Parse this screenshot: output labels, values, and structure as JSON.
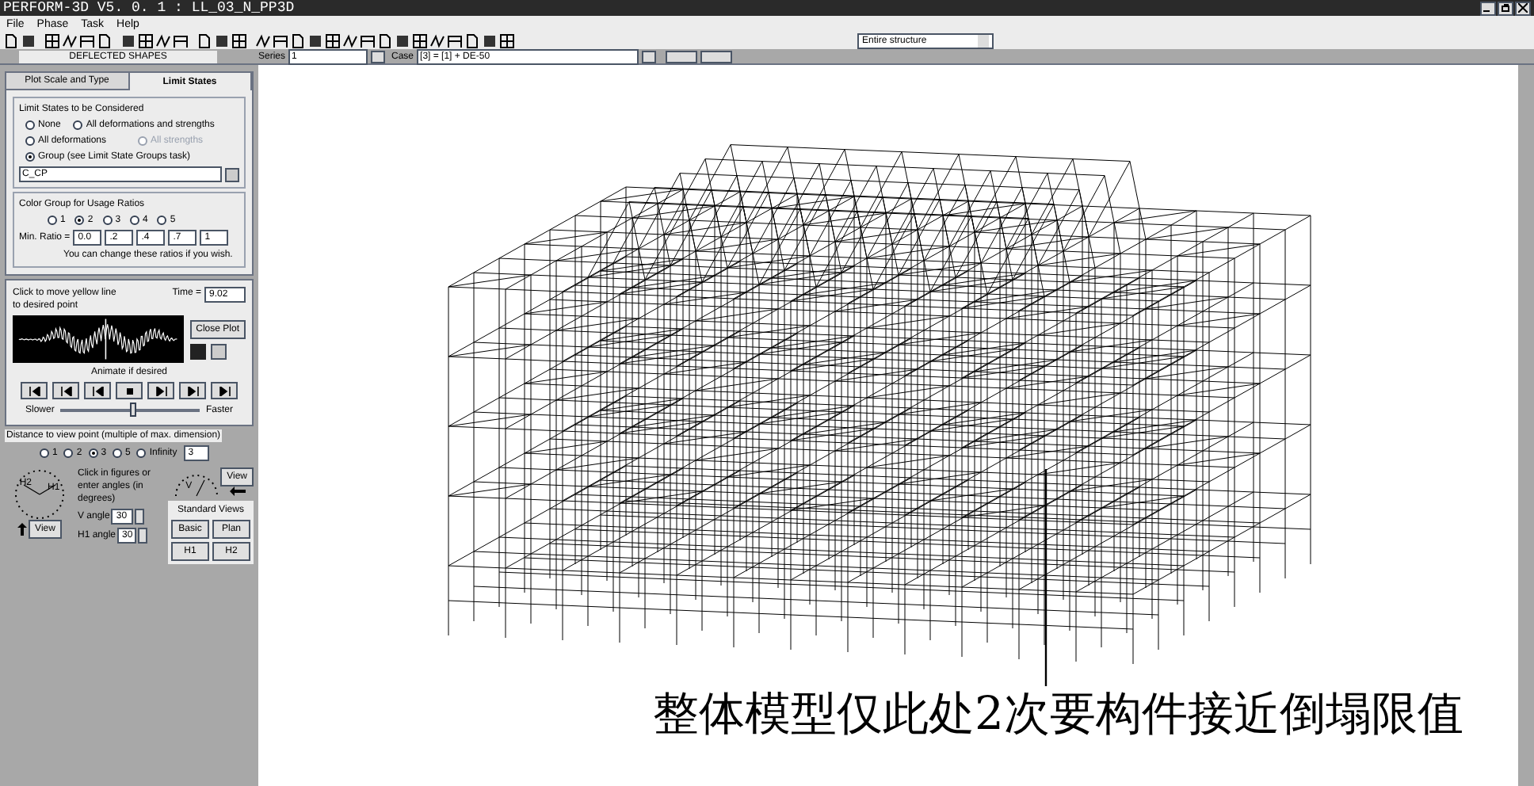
{
  "window": {
    "title": "PERFORM-3D V5. 0. 1 : LL_03_N_PP3D"
  },
  "menu": [
    "File",
    "Phase",
    "Task",
    "Help"
  ],
  "toolbar": {
    "scope": "Entire structure"
  },
  "options_bar": {
    "panel_title": "DEFLECTED SHAPES",
    "series_label": "Series",
    "series": "1",
    "case_label": "Case",
    "case": "[3] = [1] + DE-50"
  },
  "tabs": [
    {
      "label": "Plot Scale and Type",
      "selected": false
    },
    {
      "label": "Limit States",
      "selected": true
    }
  ],
  "limit_states": {
    "title": "Limit States to be Considered",
    "options": [
      {
        "label": "None",
        "selected": false,
        "disabled": false
      },
      {
        "label": "All deformations and strengths",
        "selected": false,
        "disabled": false
      },
      {
        "label": "All deformations",
        "selected": false,
        "disabled": false
      },
      {
        "label": "All strengths",
        "selected": false,
        "disabled": true
      },
      {
        "label": "Group (see Limit State Groups task)",
        "selected": true,
        "disabled": false
      }
    ],
    "group": "C_CP"
  },
  "color_group": {
    "title": "Color Group for Usage Ratios",
    "options": [
      {
        "label": "1",
        "selected": false
      },
      {
        "label": "2",
        "selected": true
      },
      {
        "label": "3",
        "selected": false
      },
      {
        "label": "4",
        "selected": false
      },
      {
        "label": "5",
        "selected": false
      }
    ],
    "ratio_label": "Min. Ratio =",
    "ratios": [
      "0.0",
      ".2",
      ".4",
      ".7",
      "1"
    ],
    "note": "You can change these ratios if you wish."
  },
  "time_history": {
    "hint": "Click to move yellow line to desired point",
    "time_label": "Time =",
    "time": "9.02",
    "close_button": "Close Plot",
    "animate_label": "Animate if desired",
    "slower": "Slower",
    "faster": "Faster",
    "speed": {
      "level": 0.52
    }
  },
  "distance": {
    "title": "Distance to view point (multiple of max. dimension)",
    "options": [
      {
        "label": "1",
        "selected": false
      },
      {
        "label": "2",
        "selected": false
      },
      {
        "label": "3",
        "selected": true
      },
      {
        "label": "5",
        "selected": false
      },
      {
        "label": "Infinity",
        "selected": false
      }
    ],
    "value": "3"
  },
  "view": {
    "h2": "H2",
    "h1": "H1",
    "v": "V",
    "view_button_left": "View",
    "view_button_right": "View",
    "hint": "Click in figures or enter angles (in degrees)",
    "v_angle_label": "V angle",
    "v_angle": "30",
    "h1_angle_label": "H1 angle",
    "h1_angle": "30",
    "standard_title": "Standard Views",
    "standard": [
      "Basic",
      "Plan",
      "H1",
      "H2"
    ]
  },
  "annotation": "整体模型仅此处2次要构件接近倒塌限值"
}
